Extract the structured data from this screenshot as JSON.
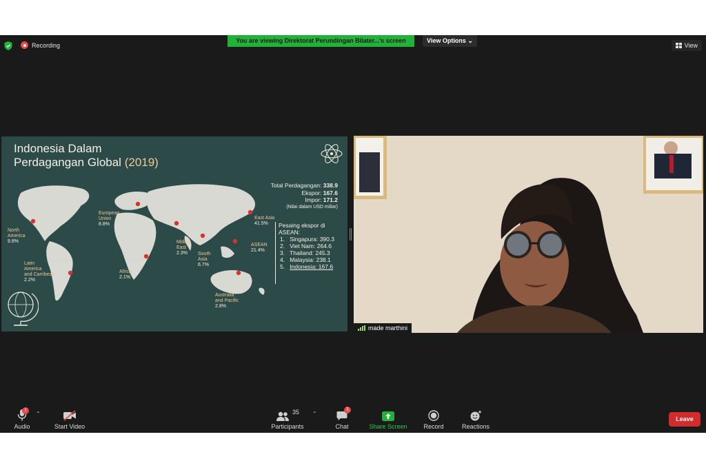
{
  "topbar": {
    "recording_label": "Recording",
    "viewing_banner": "You are viewing Direktorat Perundingan Bilater...'s screen",
    "view_options_label": "View Options",
    "view_label": "View"
  },
  "slide": {
    "title_line1": "Indonesia Dalam",
    "title_line2": "Perdagangan Global",
    "title_year": "(2019)",
    "trade": {
      "total_label": "Total Perdagangan:",
      "total_value": "338.9",
      "export_label": "Ekspor:",
      "export_value": "167.6",
      "import_label": "Impor:",
      "import_value": "171.2",
      "note": "(Nilai dalam USD miliar)"
    },
    "regions": [
      {
        "name": "North America",
        "line1": "North",
        "line2": "America",
        "pct": "9.8%"
      },
      {
        "name": "Latin America and Carribean",
        "line1": "Latin",
        "line2": "America",
        "line3": "and Carribean",
        "pct": "2.2%"
      },
      {
        "name": "European Union",
        "line1": "European",
        "line2": "Union",
        "pct": "8.8%"
      },
      {
        "name": "Africa",
        "line1": "Africa",
        "pct": "2.1%"
      },
      {
        "name": "Middle East",
        "line1": "Middle",
        "line2": "East",
        "pct": "2.3%"
      },
      {
        "name": "South Asia",
        "line1": "South",
        "line2": "Asia",
        "pct": "6.7%"
      },
      {
        "name": "East Asia",
        "line1": "East Asia",
        "pct": "41.5%"
      },
      {
        "name": "ASEAN",
        "line1": "ASEAN",
        "pct": "21.4%"
      },
      {
        "name": "Australia and Pacific",
        "line1": "Australia",
        "line2": "and Pacific",
        "pct": "2.8%"
      }
    ],
    "rivals_title_line1": "Pesaing ekspor di",
    "rivals_title_line2": "ASEAN:",
    "rivals": [
      {
        "num": "1.",
        "name": "Singapura:",
        "value": "390.3"
      },
      {
        "num": "2.",
        "name": "Viet Nam:",
        "value": "264.6"
      },
      {
        "num": "3.",
        "name": "Thailand:",
        "value": "245.3"
      },
      {
        "num": "4.",
        "name": "Malaysia:",
        "value": "238.1"
      },
      {
        "num": "5.",
        "name": "Indonesia:",
        "value": "167.6"
      }
    ]
  },
  "video": {
    "participant_name": "made marthini"
  },
  "toolbar": {
    "audio_label": "Audio",
    "audio_badge": "!",
    "start_video_label": "Start Video",
    "participants_label": "Participants",
    "participants_count": "35",
    "chat_label": "Chat",
    "chat_badge": "1",
    "share_screen_label": "Share Screen",
    "record_label": "Record",
    "reactions_label": "Reactions",
    "leave_label": "Leave"
  },
  "colors": {
    "share_green": "#22b23a",
    "leave_red": "#d22b2b",
    "slide_bg": "#2c4a47",
    "map_pin": "#d6322e"
  }
}
